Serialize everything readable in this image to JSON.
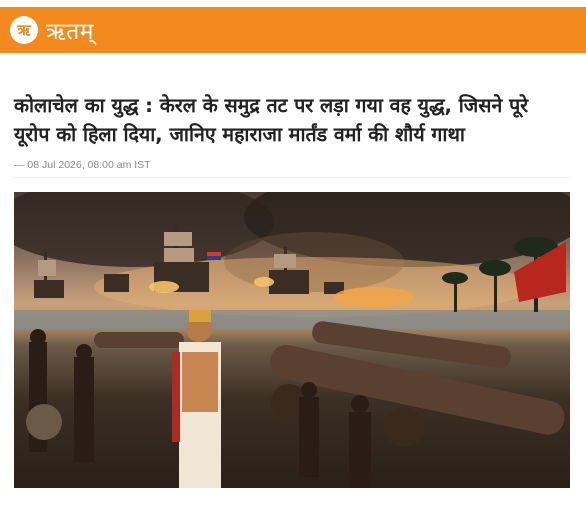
{
  "site": {
    "logo_glyph": "ऋ",
    "name": "ऋतम्",
    "brand_color": "#f28a1d"
  },
  "article": {
    "headline": "कोलाचेल का युद्ध : केरल के समुद्र तट पर लड़ा गया वह युद्ध, जिसने पूरे यूरोप को हिला दिया, जानिए महाराजा मार्तंड वर्मा की शौर्य गाथा",
    "meta": "— 08 Jul 2026, 08:00 am IST"
  }
}
